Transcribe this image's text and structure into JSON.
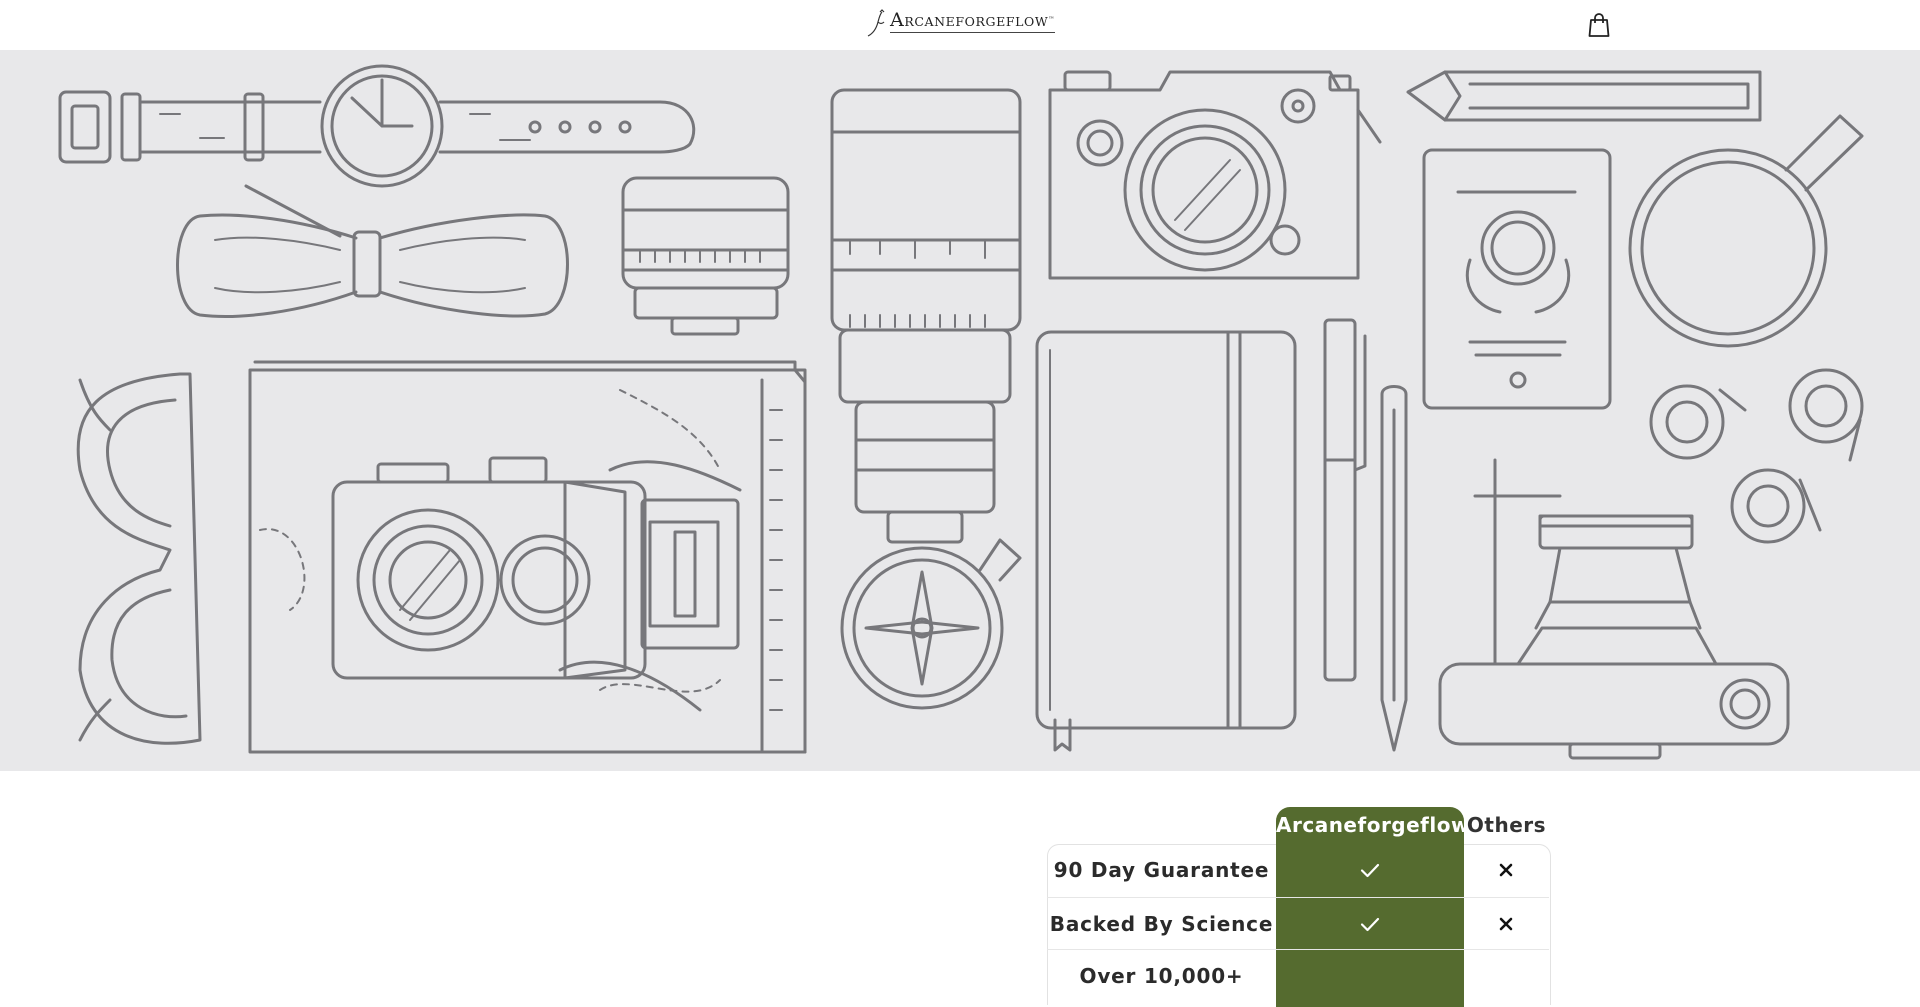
{
  "header": {
    "logo_first_letter": "A",
    "logo_rest": "RCANEFORGEFLOW",
    "logo_tm": "™",
    "cart_icon": "shopping-bag-icon"
  },
  "hero": {
    "illustration": "line-art flat lay: wristwatch, bow tie, camera lens, zoom lens, camera, pencil, passport, magnifying glass, sunglasses, map, twin-lens camera, compass, notebook, pen, pencil, tape rolls, vintage camera"
  },
  "comparison": {
    "brand_header": "Arcaneforgeflow",
    "others_header": "Others",
    "accent_color": "#556b2f",
    "rows": [
      {
        "feature": "90 Day Guarantee",
        "brand": "check-icon",
        "others": "x-icon"
      },
      {
        "feature": "Backed By Science",
        "brand": "check-icon",
        "others": "x-icon"
      },
      {
        "feature": "Over 10,000+",
        "brand": "",
        "others": ""
      }
    ]
  }
}
